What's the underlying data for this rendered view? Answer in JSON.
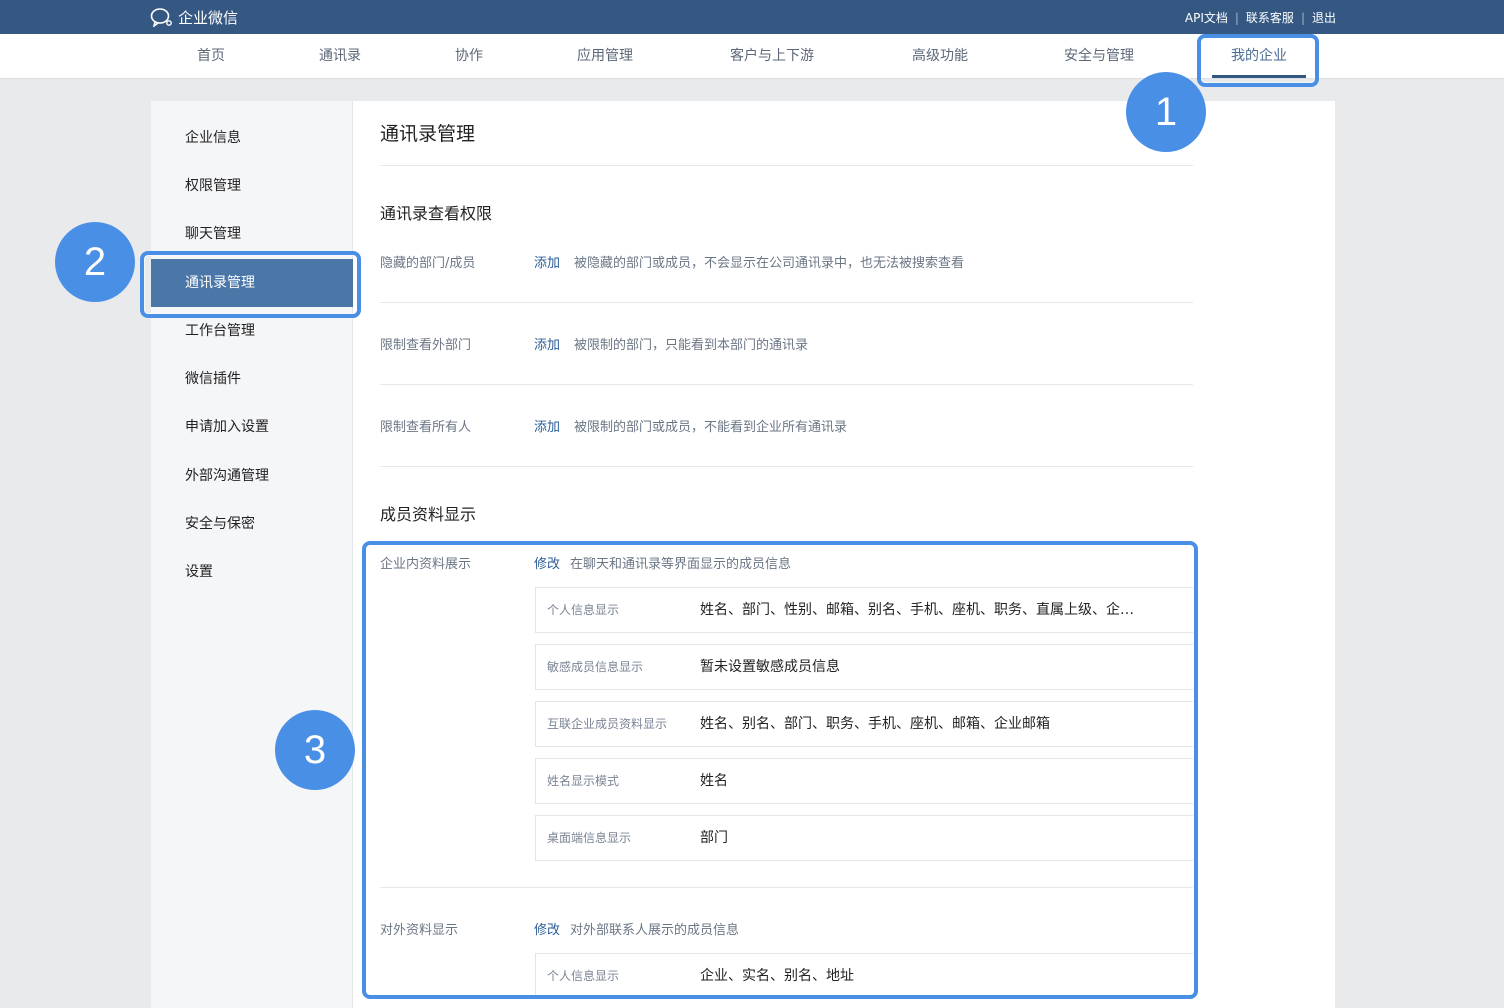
{
  "app": {
    "brand": "企业微信",
    "top_links": [
      "API文档",
      "联系客服",
      "退出"
    ]
  },
  "nav": {
    "items": [
      "首页",
      "通讯录",
      "协作",
      "应用管理",
      "客户与上下游",
      "高级功能",
      "安全与管理",
      "我的企业"
    ],
    "active_index": 7
  },
  "sidebar": {
    "items": [
      "企业信息",
      "权限管理",
      "聊天管理",
      "通讯录管理",
      "工作台管理",
      "微信插件",
      "申请加入设置",
      "外部沟通管理",
      "安全与保密",
      "设置"
    ],
    "active_index": 3
  },
  "content": {
    "title": "通讯录管理",
    "section1": {
      "title": "通讯录查看权限",
      "rows": [
        {
          "label": "隐藏的部门/成员",
          "action": "添加",
          "desc": "被隐藏的部门或成员，不会显示在公司通讯录中，也无法被搜索查看"
        },
        {
          "label": "限制查看外部门",
          "action": "添加",
          "desc": "被限制的部门，只能看到本部门的通讯录"
        },
        {
          "label": "限制查看所有人",
          "action": "添加",
          "desc": "被限制的部门或成员，不能看到企业所有通讯录"
        }
      ]
    },
    "section2": {
      "title": "成员资料显示",
      "internal": {
        "label": "企业内资料展示",
        "action": "修改",
        "desc": "在聊天和通讯录等界面显示的成员信息",
        "rows": [
          {
            "key": "个人信息显示",
            "value": "姓名、部门、性别、邮箱、别名、手机、座机、职务、直属上级、企…"
          },
          {
            "key": "敏感成员信息显示",
            "value": "暂未设置敏感成员信息"
          },
          {
            "key": "互联企业成员资料显示",
            "value": "姓名、别名、部门、职务、手机、座机、邮箱、企业邮箱"
          },
          {
            "key": "姓名显示模式",
            "value": "姓名"
          },
          {
            "key": "桌面端信息显示",
            "value": "部门"
          }
        ]
      },
      "external": {
        "label": "对外资料显示",
        "action": "修改",
        "desc": "对外部联系人展示的成员信息",
        "rows": [
          {
            "key": "个人信息显示",
            "value": "企业、实名、别名、地址"
          }
        ]
      }
    }
  },
  "annotations": {
    "badges": [
      "1",
      "2",
      "3"
    ],
    "color": "#4a8fe6"
  },
  "colors": {
    "topbar": "#355883",
    "sidebar_active": "#4a76a8",
    "link": "#2b5d9a"
  }
}
